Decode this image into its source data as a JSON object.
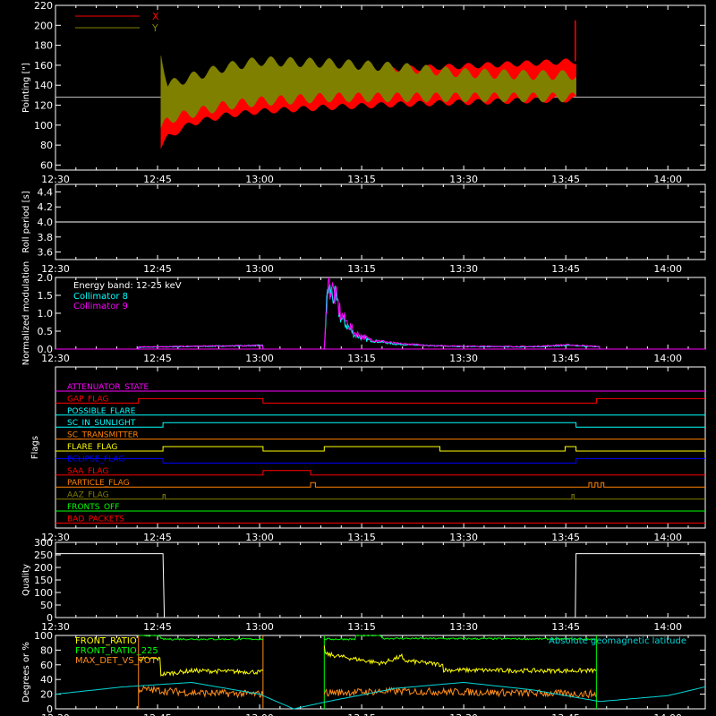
{
  "colors": {
    "background": "#000000",
    "axes": "#ffffff",
    "x_series": "#ff0000",
    "y_series": "#808000",
    "coll8": "#00ffff",
    "coll9": "#ff00ff",
    "front_ratio": "#ffff00",
    "front_ratio_225": "#00ff00",
    "max_det": "#ff8c1a",
    "geomag": "#00d8d8"
  },
  "shared_x": {
    "tick_labels": [
      "12:30",
      "12:45",
      "13:00",
      "13:15",
      "13:30",
      "13:45",
      "14:00"
    ],
    "tick_minutes": [
      0,
      15,
      30,
      45,
      60,
      75,
      90
    ],
    "range_minutes": [
      0,
      95.5
    ],
    "note_units": "minutes after 12:30 UT"
  },
  "chart_data": [
    {
      "type": "area",
      "panel": "pointing",
      "ylabel": "Pointing [\"]",
      "ylim": [
        55,
        220
      ],
      "ytick_labels": [
        "60",
        "80",
        "100",
        "120",
        "140",
        "160",
        "180",
        "200",
        "220"
      ],
      "ytick_values": [
        60,
        80,
        100,
        120,
        140,
        160,
        180,
        200,
        220
      ],
      "reference_line": 128,
      "legend": [
        "X",
        "Y"
      ],
      "legend_position": "top-left",
      "data_span_minutes": [
        15.5,
        76.5
      ],
      "series": [
        {
          "name": "X",
          "x": [
            15.5,
            16.5,
            20,
            25,
            30,
            40,
            50,
            60,
            70,
            76.5
          ],
          "upper": [
            148,
            135,
            142,
            145,
            148,
            152,
            156,
            159,
            162,
            164
          ],
          "lower": [
            78,
            88,
            102,
            110,
            114,
            118,
            121,
            123,
            125,
            126
          ],
          "spikes": [
            {
              "x": 76.4,
              "y": 205
            }
          ]
        },
        {
          "name": "Y",
          "x": [
            15.5,
            16.5,
            20,
            25,
            30,
            40,
            50,
            60,
            70,
            76.5
          ],
          "upper": [
            172,
            140,
            148,
            158,
            164,
            162,
            158,
            152,
            150,
            150
          ],
          "lower": [
            95,
            106,
            112,
            120,
            124,
            128,
            128,
            128,
            128,
            128
          ]
        }
      ]
    },
    {
      "type": "line",
      "panel": "roll",
      "ylabel": "Roll period [s]",
      "ylim": [
        3.5,
        4.5
      ],
      "ytick_labels": [
        "3.6",
        "3.8",
        "4.0",
        "4.2",
        "4.4"
      ],
      "ytick_values": [
        3.6,
        3.8,
        4.0,
        4.2,
        4.4
      ],
      "series": [
        {
          "name": "",
          "x": [
            0,
            95.5
          ],
          "y": [
            4.0,
            4.0
          ]
        }
      ]
    },
    {
      "type": "line",
      "panel": "modulation",
      "ylabel": "Normalized modulation",
      "ylim": [
        0,
        2.0
      ],
      "ytick_labels": [
        "0.0",
        "0.5",
        "1.0",
        "1.5",
        "2.0"
      ],
      "ytick_values": [
        0,
        0.5,
        1.0,
        1.5,
        2.0
      ],
      "annotation": "Energy band: 12-25 keV",
      "legend_position": "top-left",
      "segments_minutes": [
        [
          12.2,
          30.5
        ],
        [
          39.5,
          80
        ]
      ],
      "series": [
        {
          "name": "Collimator 8",
          "x": [
            12.2,
            30.5,
            39.5,
            40,
            41,
            42,
            44,
            46,
            50,
            55,
            60,
            70,
            75,
            80
          ],
          "y": [
            0.05,
            0.1,
            0.0,
            1.7,
            1.45,
            0.85,
            0.4,
            0.25,
            0.14,
            0.09,
            0.07,
            0.06,
            0.1,
            0.06
          ]
        },
        {
          "name": "Collimator 9",
          "x": [
            12.2,
            30.5,
            39.5,
            40,
            41,
            42,
            44,
            46,
            50,
            55,
            60,
            70,
            75,
            80
          ],
          "y": [
            0.06,
            0.1,
            0.0,
            1.85,
            1.55,
            0.95,
            0.45,
            0.28,
            0.16,
            0.1,
            0.08,
            0.07,
            0.12,
            0.07
          ]
        }
      ]
    },
    {
      "type": "line",
      "panel": "flags",
      "ylabel": "Flags",
      "flags": [
        {
          "name": "ATTENUATOR_STATE",
          "color": "#ff00ff",
          "edges": [],
          "initial": 0
        },
        {
          "name": "GAP_FLAG",
          "color": "#ff0000",
          "edges": [
            12.2,
            30.5,
            79.5
          ],
          "initial": 0
        },
        {
          "name": "POSSIBLE_FLARE",
          "color": "#00ffff",
          "edges": [],
          "initial": 0
        },
        {
          "name": "SC_IN_SUNLIGHT",
          "color": "#00ffff",
          "edges": [
            15.8,
            76.5
          ],
          "initial": 0
        },
        {
          "name": "SC_TRANSMITTER",
          "color": "#ff8000",
          "edges": [],
          "initial": 0
        },
        {
          "name": "FLARE_FLAG",
          "color": "#ffff00",
          "edges": [
            15.8,
            30.5,
            39.5,
            56.5,
            74.9,
            76.5
          ],
          "initial": 0
        },
        {
          "name": "ECLIPSE_FLAG",
          "color": "#0000ff",
          "edges": [
            15.8,
            76.5
          ],
          "initial": 1
        },
        {
          "name": "SAA_FLAG",
          "color": "#ff0000",
          "edges": [
            30.5,
            37.5
          ],
          "initial": 0
        },
        {
          "name": "PARTICLE_FLAG",
          "color": "#ff8000",
          "edges": [
            37.5,
            38.2,
            78.4,
            78.8,
            79.3,
            79.7,
            80.2,
            80.6
          ],
          "initial": 0
        },
        {
          "name": "AAZ_FLAG",
          "color": "#808000",
          "edges": [
            15.8,
            16.1,
            75.9,
            76.2
          ],
          "initial": 0
        },
        {
          "name": "FRONTS_OFF",
          "color": "#00ff00",
          "edges": [],
          "initial": 0
        },
        {
          "name": "BAD_PACKETS",
          "color": "#ff0000",
          "edges": [],
          "initial": 0
        }
      ]
    },
    {
      "type": "line",
      "panel": "quality",
      "ylabel": "Quality",
      "ylim": [
        0,
        300
      ],
      "ytick_labels": [
        "0",
        "50",
        "100",
        "150",
        "200",
        "250",
        "300"
      ],
      "ytick_values": [
        0,
        50,
        100,
        150,
        200,
        250,
        300
      ],
      "series": [
        {
          "name": "",
          "x": [
            0,
            15.8,
            16.0,
            76.4,
            76.5,
            95.5
          ],
          "y": [
            255,
            255,
            0,
            0,
            255,
            255
          ]
        }
      ]
    },
    {
      "type": "line",
      "panel": "ratios",
      "ylabel": "Degrees or %",
      "ylim": [
        0,
        100
      ],
      "ytick_labels": [
        "0",
        "20",
        "40",
        "60",
        "80",
        "100"
      ],
      "ytick_values": [
        0,
        20,
        40,
        60,
        80,
        100
      ],
      "legend_position": "top-left",
      "right_annotation": "Absolute geomagnetic latitude",
      "series": [
        {
          "name": "FRONT_RATIO",
          "x": [
            12.2,
            15.5,
            15.5,
            20,
            30.5,
            39.5,
            39.5,
            44,
            48,
            51,
            51,
            57,
            57,
            70,
            79.5
          ],
          "y": [
            68,
            68,
            47,
            52,
            50,
            88,
            75,
            68,
            62,
            72,
            66,
            60,
            53,
            52,
            52
          ]
        },
        {
          "name": "FRONT_RATIO_225",
          "x": [
            12.2,
            15.5,
            15.5,
            30.5,
            39.5,
            44,
            44,
            48,
            48,
            79.5
          ],
          "y": [
            100,
            100,
            95,
            95,
            95,
            95,
            100,
            100,
            96,
            95
          ]
        },
        {
          "name": "MAX_DET_VS_TOT",
          "x": [
            12.2,
            20,
            30.5,
            39.5,
            50,
            60,
            79.5
          ],
          "y": [
            27,
            22,
            20,
            22,
            24,
            23,
            20
          ]
        },
        {
          "name": "",
          "x": [
            0,
            10,
            20,
            30,
            35,
            40,
            50,
            60,
            70,
            80,
            90,
            95.5
          ],
          "y": [
            20,
            30,
            36,
            20,
            0,
            10,
            28,
            36,
            26,
            10,
            18,
            30
          ]
        }
      ]
    }
  ]
}
